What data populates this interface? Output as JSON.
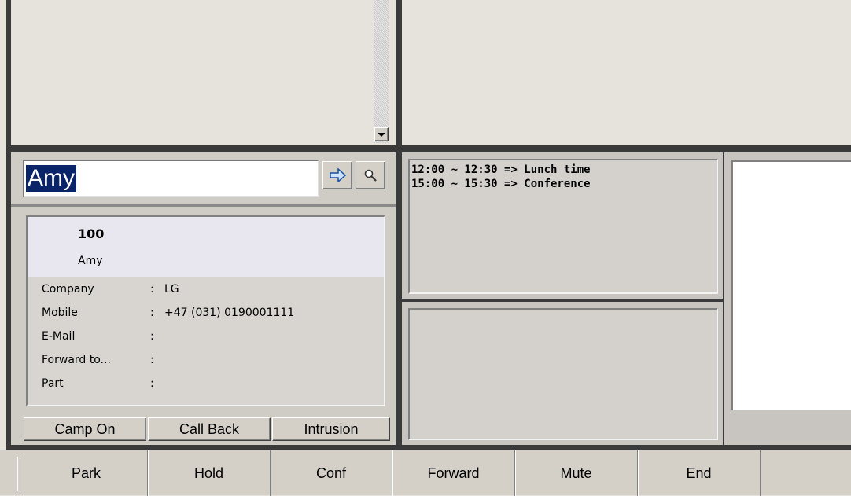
{
  "search": {
    "value": "Amy"
  },
  "contact": {
    "number": "100",
    "name": "Amy",
    "fields": [
      {
        "label": "Company",
        "value": "LG"
      },
      {
        "label": "Mobile",
        "value": "+47 (031) 0190001111"
      },
      {
        "label": "E-Mail",
        "value": ""
      },
      {
        "label": "Forward to...",
        "value": ""
      },
      {
        "label": "Part",
        "value": ""
      }
    ]
  },
  "actions": {
    "camp_on": "Camp On",
    "call_back": "Call Back",
    "intrusion": "Intrusion"
  },
  "schedule": {
    "lines": [
      "12:00 ~ 12:30 => Lunch time",
      "15:00 ~ 15:30 => Conference"
    ]
  },
  "callbar": {
    "park": "Park",
    "hold": "Hold",
    "conf": "Conf",
    "forward": "Forward",
    "mute": "Mute",
    "end": "End"
  },
  "icons": {
    "go": "arrow-right-icon",
    "find": "magnifier-icon",
    "scroll": "scroll-down-arrow-icon"
  }
}
